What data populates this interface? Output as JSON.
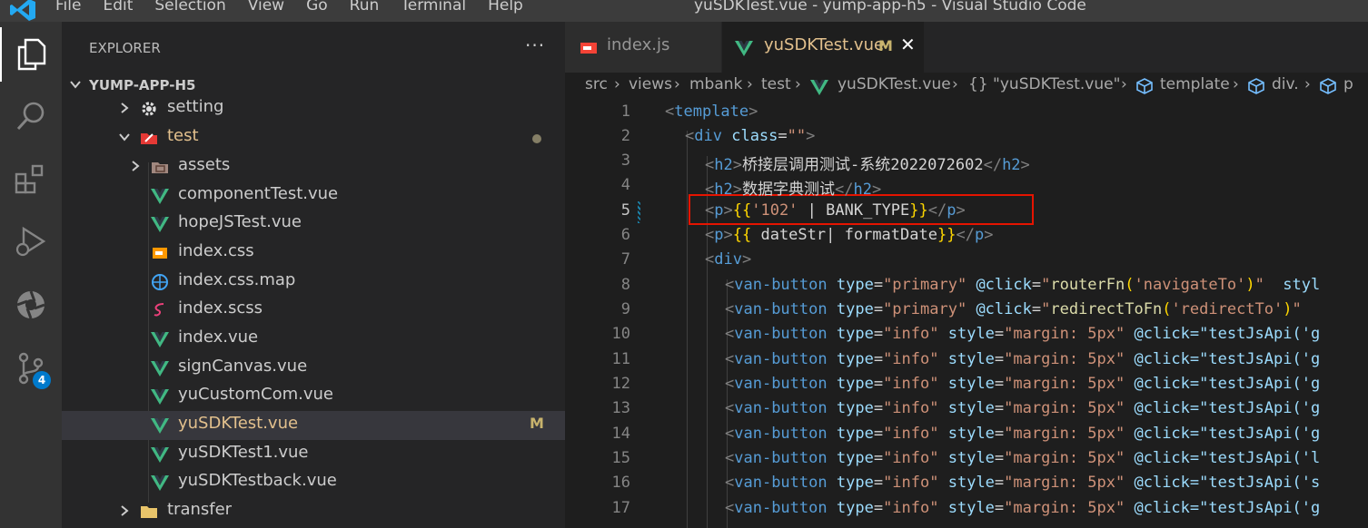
{
  "titlebar": {
    "menu": [
      "File",
      "Edit",
      "Selection",
      "View",
      "Go",
      "Run",
      "Terminal",
      "Help"
    ],
    "window_title": "yuSDKTest.vue - yump-app-h5 - Visual Studio Code"
  },
  "activity_bar": {
    "items": [
      "explorer-icon",
      "search-icon",
      "extensions-icon",
      "run-debug-icon",
      "remote-icon",
      "source-control-icon"
    ],
    "scm_badge": "4"
  },
  "explorer": {
    "header": "EXPLORER",
    "more": "···",
    "root": "YUMP-APP-H5",
    "items": [
      {
        "label": "setting",
        "icon": "gear-folder-icon",
        "kind": "folder-collapsed"
      },
      {
        "label": "test",
        "icon": "test-folder-icon",
        "kind": "folder-expanded",
        "modified_dot": true
      },
      {
        "label": "assets",
        "icon": "assets-folder-icon",
        "kind": "folder-collapsed"
      },
      {
        "label": "componentTest.vue",
        "icon": "vue-icon",
        "kind": "file"
      },
      {
        "label": "hopeJSTest.vue",
        "icon": "vue-icon",
        "kind": "file"
      },
      {
        "label": "index.css",
        "icon": "css-file-icon",
        "kind": "file"
      },
      {
        "label": "index.css.map",
        "icon": "css-map-icon",
        "kind": "file"
      },
      {
        "label": "index.scss",
        "icon": "sass-icon",
        "kind": "file"
      },
      {
        "label": "index.vue",
        "icon": "vue-icon",
        "kind": "file"
      },
      {
        "label": "signCanvas.vue",
        "icon": "vue-icon",
        "kind": "file"
      },
      {
        "label": "yuCustomCom.vue",
        "icon": "vue-icon",
        "kind": "file"
      },
      {
        "label": "yuSDKTest.vue",
        "icon": "vue-icon",
        "kind": "file",
        "selected": true,
        "flag": "M"
      },
      {
        "label": "yuSDKTest1.vue",
        "icon": "vue-icon",
        "kind": "file"
      },
      {
        "label": "yuSDKTestback.vue",
        "icon": "vue-icon",
        "kind": "file"
      },
      {
        "label": "transfer",
        "icon": "folder-icon",
        "kind": "folder-collapsed"
      }
    ]
  },
  "tabs": [
    {
      "label": "index.js",
      "icon": "js-file-icon",
      "active": false
    },
    {
      "label": "yuSDKTest.vue",
      "icon": "vue-icon",
      "active": true,
      "flag": "M",
      "close": "✕"
    }
  ],
  "breadcrumb": [
    "src",
    "views",
    "mbank",
    "test",
    "yuSDKTest.vue",
    "{} \"yuSDKTest.vue\"",
    "template",
    "div.",
    "p"
  ],
  "editor": {
    "current_line": 5,
    "lines": [
      {
        "n": "1",
        "text": "<template>"
      },
      {
        "n": "2",
        "text": "<div class=\"\">"
      },
      {
        "n": "3",
        "text": "<h2>桥接层调用测试-系统2022072602</h2>"
      },
      {
        "n": "4",
        "text": "<h2>数据字典测试</h2>"
      },
      {
        "n": "5",
        "text": "<p>{{'102' | BANK_TYPE}}</p>"
      },
      {
        "n": "6",
        "text": "<p>{{ dateStr| formatDate}}</p>"
      },
      {
        "n": "7",
        "text": "<div>"
      },
      {
        "n": "8",
        "text": "<van-button type=\"primary\" @click=\"routerFn('navigateTo')\"  styl"
      },
      {
        "n": "9",
        "text": "<van-button type=\"primary\" @click=\"redirectToFn('redirectTo')\""
      },
      {
        "n": "10",
        "text": "<van-button type=\"info\" style=\"margin: 5px\" @click=\"testJsApi('g"
      },
      {
        "n": "11",
        "text": "<van-button type=\"info\" style=\"margin: 5px\" @click=\"testJsApi('g"
      },
      {
        "n": "12",
        "text": "<van-button type=\"info\" style=\"margin: 5px\" @click=\"testJsApi('g"
      },
      {
        "n": "13",
        "text": "<van-button type=\"info\" style=\"margin: 5px\" @click=\"testJsApi('g"
      },
      {
        "n": "14",
        "text": "<van-button type=\"info\" style=\"margin: 5px\" @click=\"testJsApi('g"
      },
      {
        "n": "15",
        "text": "<van-button type=\"info\" style=\"margin: 5px\" @click=\"testJsApi('l"
      },
      {
        "n": "16",
        "text": "<van-button type=\"info\" style=\"margin: 5px\" @click=\"testJsApi('s"
      },
      {
        "n": "17",
        "text": "<van-button type=\"info\" style=\"margin: 5px\" @click=\"testJsApi('g"
      }
    ]
  },
  "colors": {
    "accent": "#007acc",
    "highlight_box": "#e51400",
    "vue_green": "#41b883",
    "modified": "#e2c08d"
  }
}
